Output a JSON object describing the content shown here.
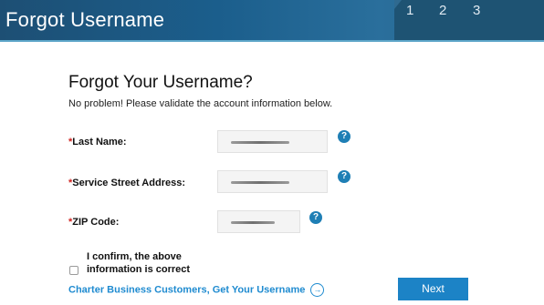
{
  "header": {
    "title": "Forgot Username",
    "steps": [
      "1",
      "2",
      "3"
    ]
  },
  "form": {
    "heading": "Forgot Your Username?",
    "subtext": "No problem! Please validate the account information below.",
    "required_marker": "*",
    "fields": [
      {
        "label": "Last Name:",
        "value": ""
      },
      {
        "label": "Service Street Address:",
        "value": ""
      },
      {
        "label": "ZIP Code:",
        "value": ""
      }
    ],
    "help_icon": "?",
    "confirm_label_line1": "I confirm, the above",
    "confirm_label_line2": "information is correct",
    "confirm_checked": false,
    "business_link": "Charter Business Customers, Get Your Username",
    "next_label": "Next"
  },
  "icons": [
    "question-icon",
    "circle-arrow-right-icon"
  ],
  "colors": {
    "banner": "#1b5e8c",
    "accent": "#1c83c6",
    "required": "#d0231f",
    "link": "#1f8bd0"
  }
}
